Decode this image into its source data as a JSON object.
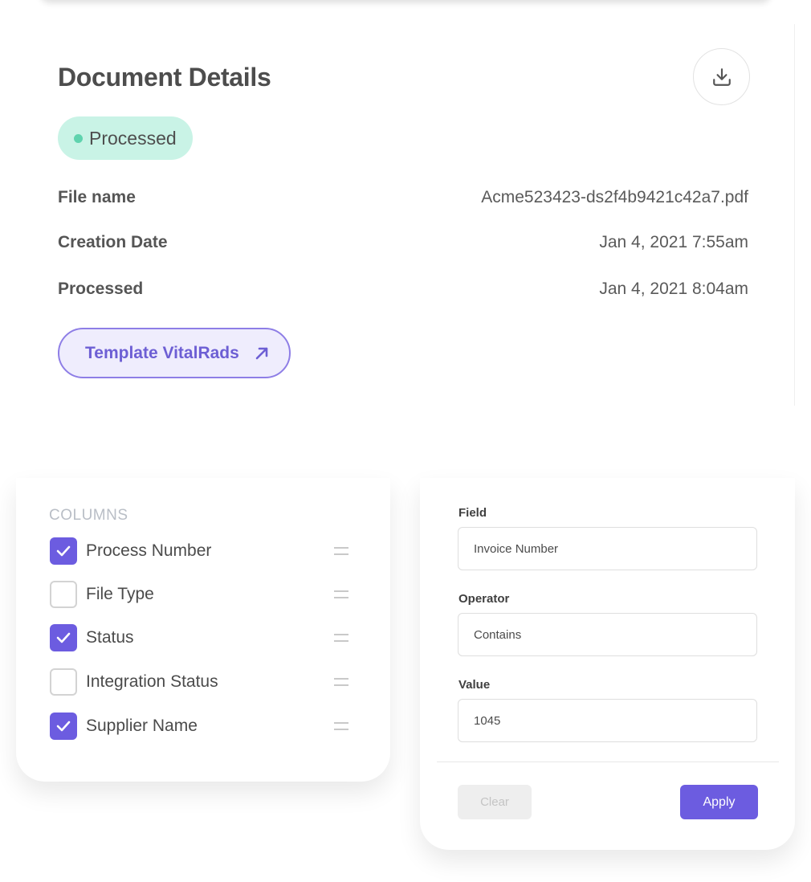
{
  "document": {
    "title": "Document Details",
    "status": "Processed",
    "download_icon": "download-icon",
    "rows": [
      {
        "label": "File name",
        "value": "Acme523423-ds2f4b9421c42a7.pdf"
      },
      {
        "label": "Creation Date",
        "value": "Jan 4, 2021 7:55am"
      },
      {
        "label": "Processed",
        "value": "Jan 4, 2021 8:04am"
      }
    ],
    "template_button": "Template VitalRads",
    "template_icon": "arrow-up-right-icon"
  },
  "columns": {
    "heading": "COLUMNS",
    "items": [
      {
        "label": "Process Number",
        "checked": true
      },
      {
        "label": "File Type",
        "checked": false
      },
      {
        "label": "Status",
        "checked": true
      },
      {
        "label": "Integration Status",
        "checked": false
      },
      {
        "label": "Supplier Name",
        "checked": true
      }
    ]
  },
  "filter": {
    "field_label": "Field",
    "field_value": "Invoice Number",
    "operator_label": "Operator",
    "operator_value": "Contains",
    "value_label": "Value",
    "value_value": "1045",
    "clear_label": "Clear",
    "apply_label": "Apply"
  },
  "colors": {
    "accent": "#6c5ce0",
    "status_bg": "#c9f3e6",
    "status_dot": "#5fd3ae"
  }
}
